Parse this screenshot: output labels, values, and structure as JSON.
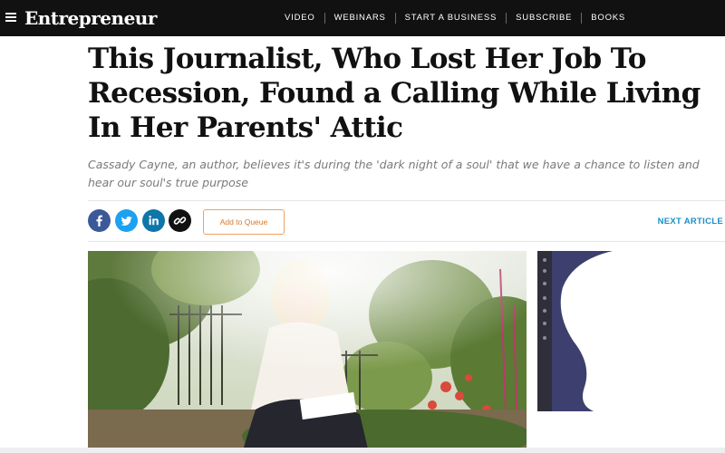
{
  "header": {
    "logo": "Entrepreneur",
    "nav": [
      "VIDEO",
      "WEBINARS",
      "START A BUSINESS",
      "SUBSCRIBE",
      "BOOKS"
    ]
  },
  "article": {
    "title": "This Journalist, Who Lost Her Job To Recession, Found a Calling While Living In Her Parents' Attic",
    "subtitle": "Cassady Cayne, an author, believes it's during the 'dark night of a soul' that we have a chance to listen and hear our soul's true purpose"
  },
  "share": {
    "icons": [
      "facebook-icon",
      "twitter-icon",
      "linkedin-icon",
      "link-icon"
    ],
    "colors": {
      "facebook": "#3b5998",
      "twitter": "#1da1f2",
      "linkedin": "#0e76a8",
      "link": "#111111"
    },
    "queue_label": "Add to Queue",
    "next_label": "NEXT ARTICLE"
  },
  "colors": {
    "topbar": "#111111",
    "accent_orange": "#f0a060",
    "accent_blue": "#1a8fc7",
    "ad_purple": "#3d3f6e"
  }
}
